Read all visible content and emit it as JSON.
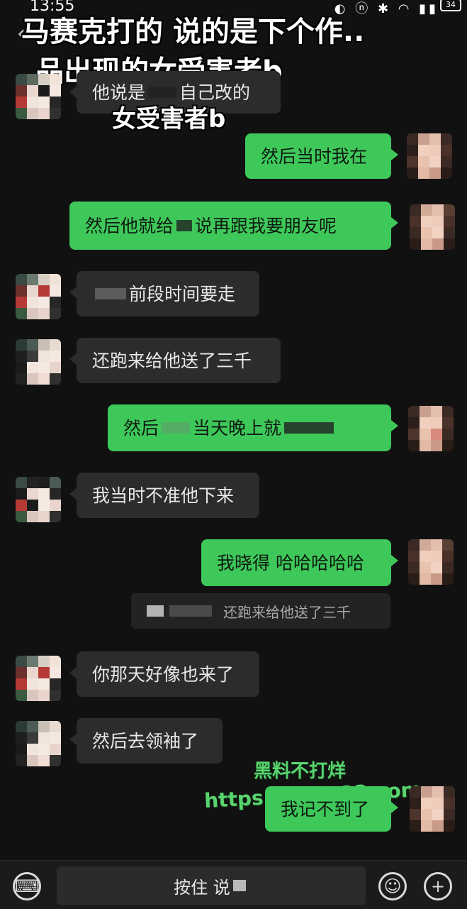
{
  "status": {
    "time": "13:55",
    "icons": "◐ ⓝ ✱ ◠ ▮▮",
    "battery": "34"
  },
  "overlay": {
    "line1": "马赛克打的 说的是下个作..",
    "line2": "品出现的女受害者b"
  },
  "messages": [
    {
      "side": "left",
      "text_a": "他说是",
      "text_b": "自己改的"
    },
    {
      "side": "annotation",
      "text": "女受害者b"
    },
    {
      "side": "right",
      "text": "然后当时我在"
    },
    {
      "side": "right",
      "text_a": "然后他就给",
      "text_b": "说再跟我要朋友呢"
    },
    {
      "side": "left",
      "text": "前段时间要走"
    },
    {
      "side": "left",
      "text": "还跑来给他送了三千"
    },
    {
      "side": "right",
      "text_a": "然后",
      "text_b": "当天晚上就"
    },
    {
      "side": "left",
      "text": "我当时不准他下来"
    },
    {
      "side": "right",
      "text": "我晓得 哈哈哈哈哈"
    },
    {
      "side": "quote",
      "text": "还跑来给他送了三千"
    },
    {
      "side": "left",
      "text": "你那天好像也来了"
    },
    {
      "side": "left",
      "text": "然后去领袖了"
    },
    {
      "side": "right",
      "text": "我记不到了"
    }
  ],
  "watermark": {
    "line1": "黑料不打烊",
    "line2": "https://abdy33.com"
  },
  "bottom": {
    "hold_to_talk": "按住 说"
  },
  "colors": {
    "background": "#111111",
    "bubble_right": "#3ec85a",
    "bubble_left": "#2c2c2c",
    "watermark": "#59d46e"
  },
  "icons": [
    "back-icon",
    "keyboard-icon",
    "emoji-icon",
    "plus-icon"
  ]
}
